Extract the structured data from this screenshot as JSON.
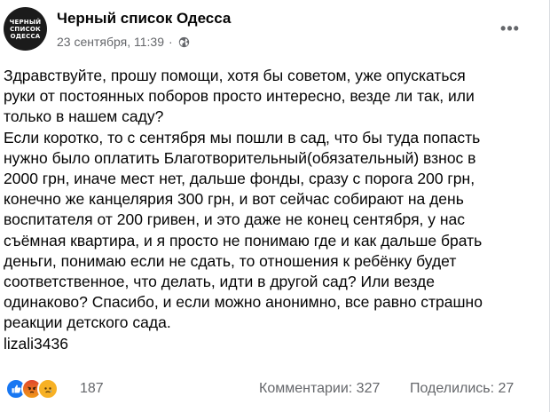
{
  "post": {
    "page_name": "Черный список Одесса",
    "avatar_text": [
      "ЧЕРНЫЙ",
      "СПИСОК",
      "ОДЕССА"
    ],
    "timestamp": "23 сентября, 11:39",
    "separator": "·",
    "visibility_icon": "globe-icon",
    "more_icon": "more-options-icon",
    "more_glyph": "•••",
    "text": "Здравствуйте, прошу помощи, хотя бы советом, уже опускаться\nруки от постоянных поборов просто интересно, везде ли так, или\nтолько в нашем саду?\nЕсли коротко, то с сентября мы пошли в сад, что бы туда попасть\nнужно было оплатить Благотворительный(обязательный) взнос в\n2000 грн, иначе мест нет, дальше фонды, сразу с порога 200 грн,\nконечно же канцелярия 300 грн, и вот сейчас собирают на день\nвоспитателя от 200 гривен, и это даже не конец сентября, у нас\nсъёмная квартира, и я просто не понимаю где и как дальше брать\nденьги, понимаю если не сдать, то отношения к ребёнку будет\nсоответственное, что делать, идти в другой сад? Или везде\nодинаково? Спасибо, и если можно анонимно, все равно страшно\nреакции детского сада.\nlizali3436"
  },
  "footer": {
    "reactions": [
      {
        "icon": "like-icon",
        "color": "#1877f2"
      },
      {
        "icon": "angry-icon",
        "color": "#e9710f"
      },
      {
        "icon": "sad-icon",
        "color": "#f7b125"
      }
    ],
    "reaction_count": "187",
    "comments_label": "Комментарии: 327",
    "shares_label": "Поделились: 27"
  }
}
